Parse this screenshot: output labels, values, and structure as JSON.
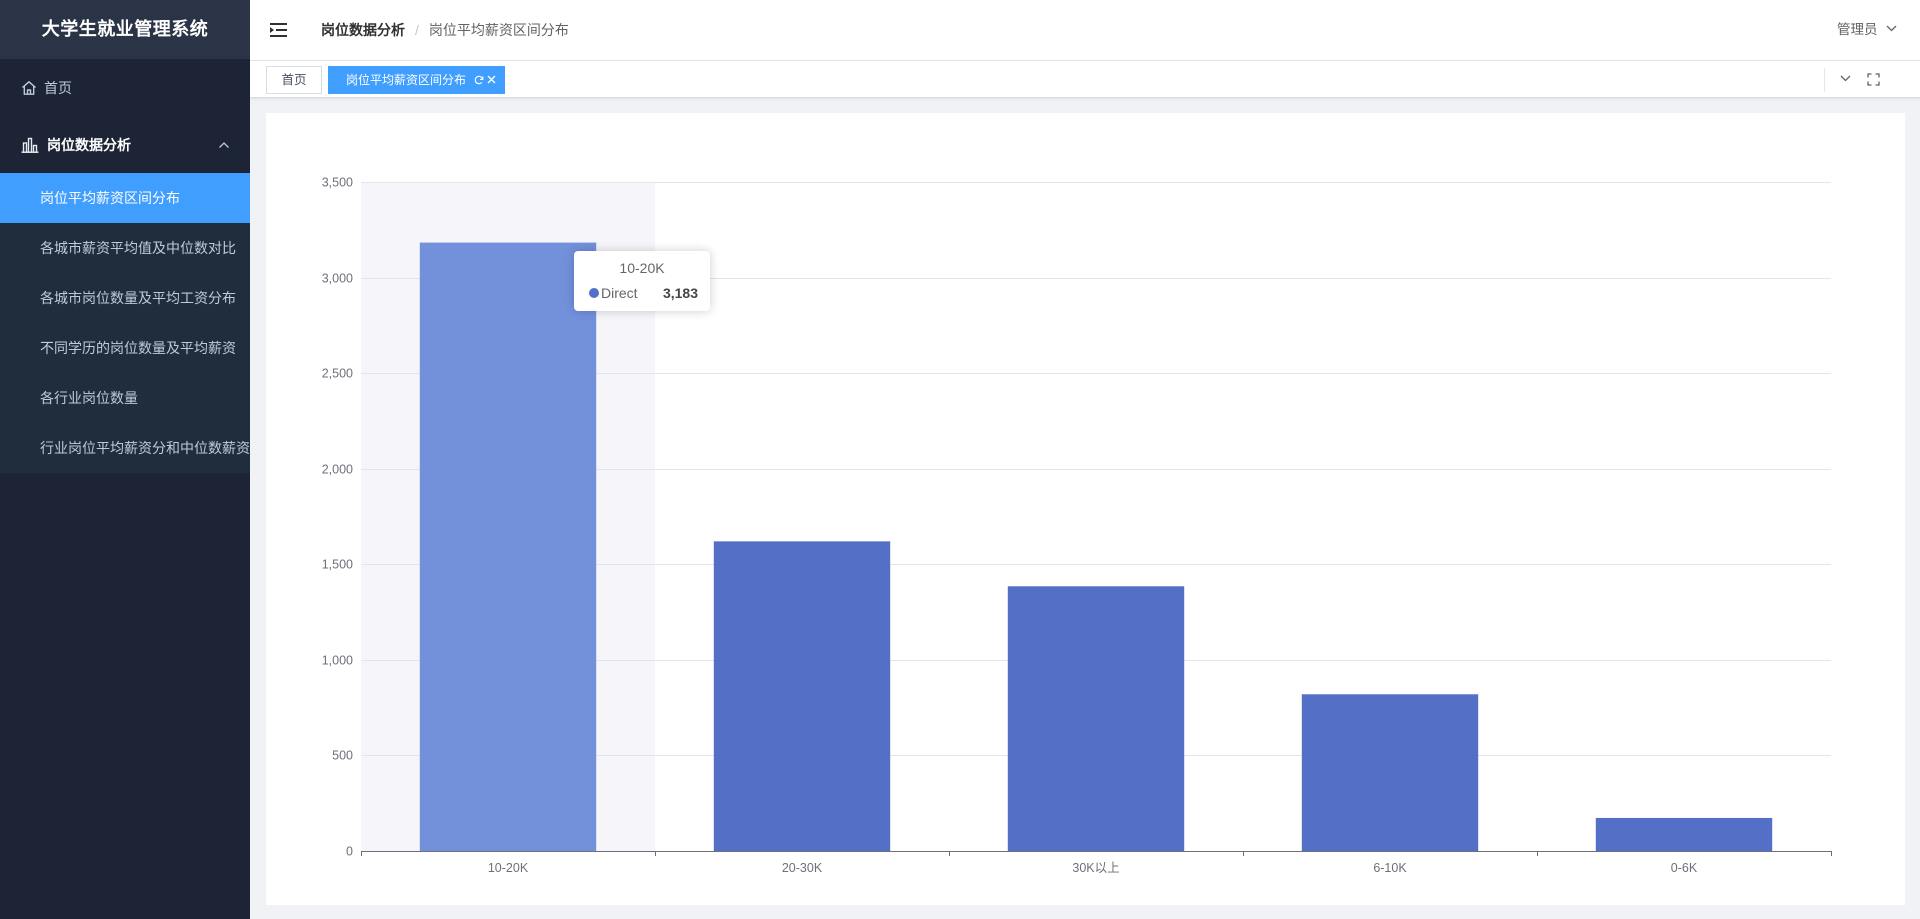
{
  "app": {
    "title": "大学生就业管理系统"
  },
  "colors": {
    "accent": "#409eff",
    "sidebar_bg": "#1d2436",
    "submenu_bg": "#1f2d3d",
    "logo_bg": "#2b3447",
    "content_bg": "#f0f2f5"
  },
  "sidebar": {
    "home": "首页",
    "group": {
      "label": "岗位数据分析",
      "expanded": true
    },
    "items": [
      {
        "label": "岗位平均薪资区间分布",
        "active": true
      },
      {
        "label": "各城市薪资平均值及中位数对比",
        "active": false
      },
      {
        "label": "各城市岗位数量及平均工资分布",
        "active": false
      },
      {
        "label": "不同学历的岗位数量及平均薪资",
        "active": false
      },
      {
        "label": "各行业岗位数量",
        "active": false
      },
      {
        "label": "行业岗位平均薪资分和中位数薪资",
        "active": false
      }
    ]
  },
  "header": {
    "breadcrumb": [
      "岗位数据分析",
      "岗位平均薪资区间分布"
    ],
    "separator": "/",
    "user": "管理员"
  },
  "tags": [
    {
      "label": "首页",
      "active": false
    },
    {
      "label": "岗位平均薪资区间分布",
      "active": true
    }
  ],
  "chart_data": {
    "type": "bar",
    "categories": [
      "10-20K",
      "20-30K",
      "30K以上",
      "6-10K",
      "0-6K"
    ],
    "series": [
      {
        "name": "Direct",
        "values": [
          3183,
          1620,
          1385,
          820,
          173
        ]
      }
    ],
    "ylim": [
      0,
      3500
    ],
    "yticks": [
      0,
      500,
      1000,
      1500,
      2000,
      2500,
      3000,
      3500
    ],
    "ytick_labels": [
      "0",
      "500",
      "1,000",
      "1,500",
      "2,000",
      "2,500",
      "3,000",
      "3,500"
    ],
    "grid": true,
    "legend": "none",
    "bar_color": "#5470c6",
    "highlight_color": "#7390db",
    "highlighted_category": "10-20K",
    "tooltip": {
      "title": "10-20K",
      "series": "Direct",
      "value": "3,183"
    }
  }
}
